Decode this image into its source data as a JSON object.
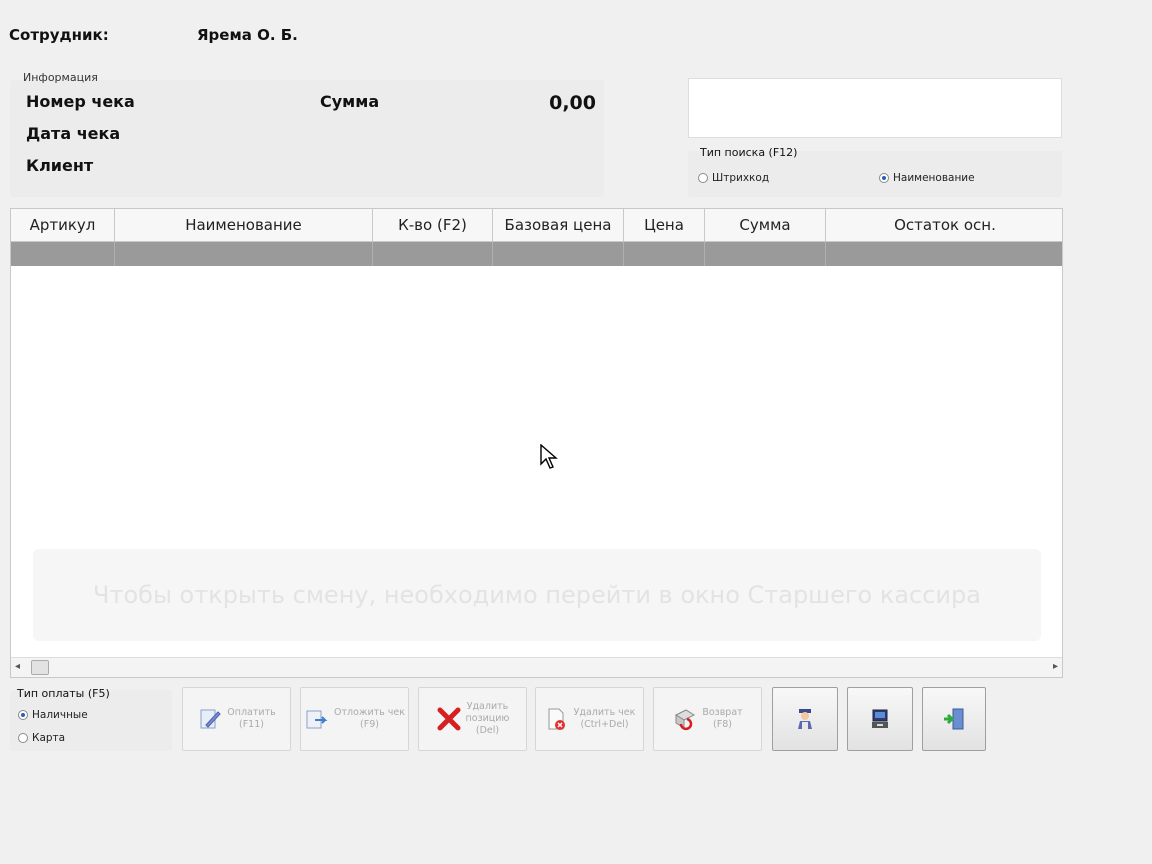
{
  "employee": {
    "label": "Сотрудник:",
    "name": "Ярема О. Б."
  },
  "info": {
    "caption": "Информация",
    "receipt_number_label": "Номер чека",
    "receipt_date_label": "Дата чека",
    "client_label": "Клиент",
    "sum_label": "Сумма",
    "sum_value": "0,00"
  },
  "search": {
    "value": "",
    "type_caption": "Тип поиска (F12)",
    "options": [
      {
        "label": "Штрихкод",
        "selected": false
      },
      {
        "label": "Наименование",
        "selected": true
      }
    ]
  },
  "grid": {
    "columns": [
      "Артикул",
      "Наименование",
      "К-во (F2)",
      "Базовая цена",
      "Цена",
      "Сумма",
      "Остаток осн."
    ],
    "notice": "Чтобы открыть смену, необходимо перейти в окно Старшего кассира"
  },
  "payment": {
    "caption": "Тип оплаты (F5)",
    "options": [
      {
        "label": "Наличные",
        "selected": true
      },
      {
        "label": "Карта",
        "selected": false
      }
    ]
  },
  "buttons": {
    "pay": {
      "label": "Оплатить\n(F11)",
      "icon": "pen-icon"
    },
    "postpone": {
      "label": "Отложить чек\n(F9)",
      "icon": "postpone-receipt-icon"
    },
    "delete_position": {
      "label": "Удалить\nпозицию\n(Del)",
      "icon": "red-x-icon"
    },
    "delete_receipt": {
      "label": "Удалить чек\n(Ctrl+Del)",
      "icon": "delete-receipt-icon"
    },
    "return": {
      "label": "Возврат\n(F8)",
      "icon": "return-icon"
    },
    "senior_cashier": {
      "icon": "cashier-person-icon"
    },
    "terminal": {
      "icon": "cash-register-icon"
    },
    "exit": {
      "icon": "exit-door-icon"
    }
  }
}
